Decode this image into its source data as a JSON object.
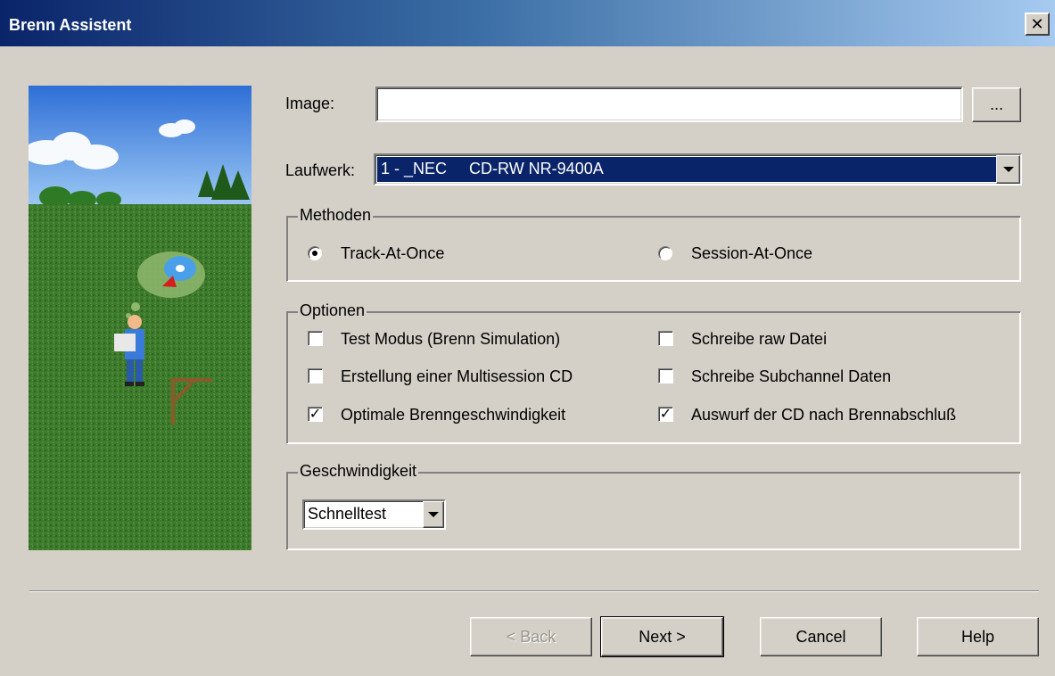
{
  "window": {
    "title": "Brenn Assistent",
    "close_glyph": "✕"
  },
  "image_field": {
    "label": "Image:",
    "value": "",
    "browse_label": "..."
  },
  "drive": {
    "label": "Laufwerk:",
    "selected": "1 - _NEC     CD-RW NR-9400A"
  },
  "methods": {
    "legend": "Methoden",
    "options": [
      {
        "label": "Track-At-Once",
        "selected": true
      },
      {
        "label": "Session-At-Once",
        "selected": false
      }
    ]
  },
  "options": {
    "legend": "Optionen",
    "items": [
      {
        "label": "Test Modus (Brenn Simulation)",
        "checked": false
      },
      {
        "label": "Erstellung einer Multisession CD",
        "checked": false
      },
      {
        "label": "Optimale Brenngeschwindigkeit",
        "checked": true
      },
      {
        "label": "Schreibe raw Datei",
        "checked": false
      },
      {
        "label": "Schreibe Subchannel Daten",
        "checked": false
      },
      {
        "label": "Auswurf der CD nach Brennabschluß",
        "checked": true
      }
    ]
  },
  "speed": {
    "legend": "Geschwindigkeit",
    "selected": "Schnelltest"
  },
  "buttons": {
    "back": "< Back",
    "next": "Next >",
    "cancel": "Cancel",
    "help": "Help"
  },
  "colors": {
    "titlebar_start": "#0a246a",
    "titlebar_end": "#a6caf0",
    "selection": "#0a246a",
    "face": "#d4d0c8"
  }
}
